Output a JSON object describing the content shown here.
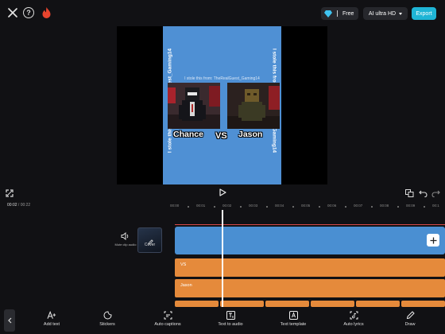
{
  "header": {
    "free_label": "Free",
    "quality_label": "AI ultra HD",
    "export_label": "Export"
  },
  "preview": {
    "side_caption": "I stole this from: TheRealGuest_Gaming14",
    "mid_caption": "I stole this from: TheRealGuest_Gaming14",
    "left_name": "Chance",
    "vs_label": "VS",
    "right_name": "Jason"
  },
  "playback": {
    "current_time": "00:02",
    "separator": "/",
    "total_time": "00:22"
  },
  "ruler": {
    "ticks": [
      "00:00",
      "00:01",
      "00:02",
      "00:03",
      "00:04",
      "00:05",
      "00:06",
      "00:07",
      "00:08",
      "00:09",
      "00:1"
    ]
  },
  "timeline": {
    "mute_label": "Mute clip audio",
    "cover_label": "Cover",
    "tracks": [
      {
        "label": "VS"
      },
      {
        "label": "Jason"
      }
    ]
  },
  "toolbar": {
    "items": [
      {
        "label": "Add text",
        "icon": "add-text-icon"
      },
      {
        "label": "Stickers",
        "icon": "sticker-icon"
      },
      {
        "label": "Auto captions",
        "icon": "auto-captions-icon"
      },
      {
        "label": "Text to audio",
        "icon": "text-to-audio-icon"
      },
      {
        "label": "Text template",
        "icon": "text-template-icon"
      },
      {
        "label": "Auto lyrics",
        "icon": "auto-lyrics-icon"
      },
      {
        "label": "Draw",
        "icon": "draw-icon"
      }
    ]
  },
  "colors": {
    "accent": "#1fb5d6",
    "main_track": "#4a8fd2",
    "text_track": "#e58a3b",
    "red_line": "#d84a4a"
  }
}
